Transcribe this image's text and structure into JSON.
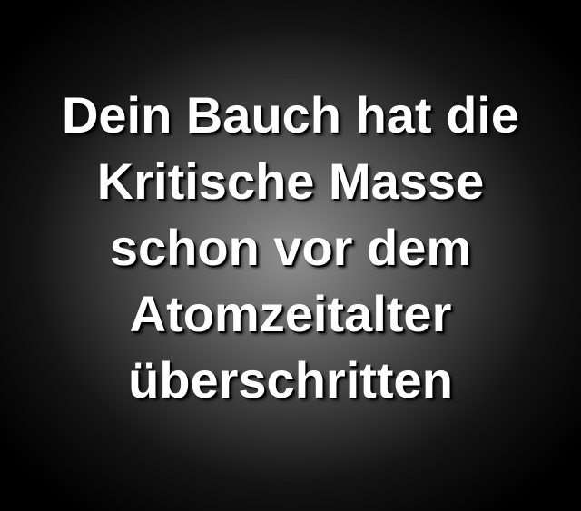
{
  "caption": {
    "lines": [
      "Dein Bauch hat die",
      "Kritische Masse",
      "schon vor dem",
      "Atomzeitalter",
      "überschritten"
    ]
  },
  "colors": {
    "text": "#ffffff",
    "background_edge": "#000000",
    "background_center": "#8f8f8f"
  }
}
